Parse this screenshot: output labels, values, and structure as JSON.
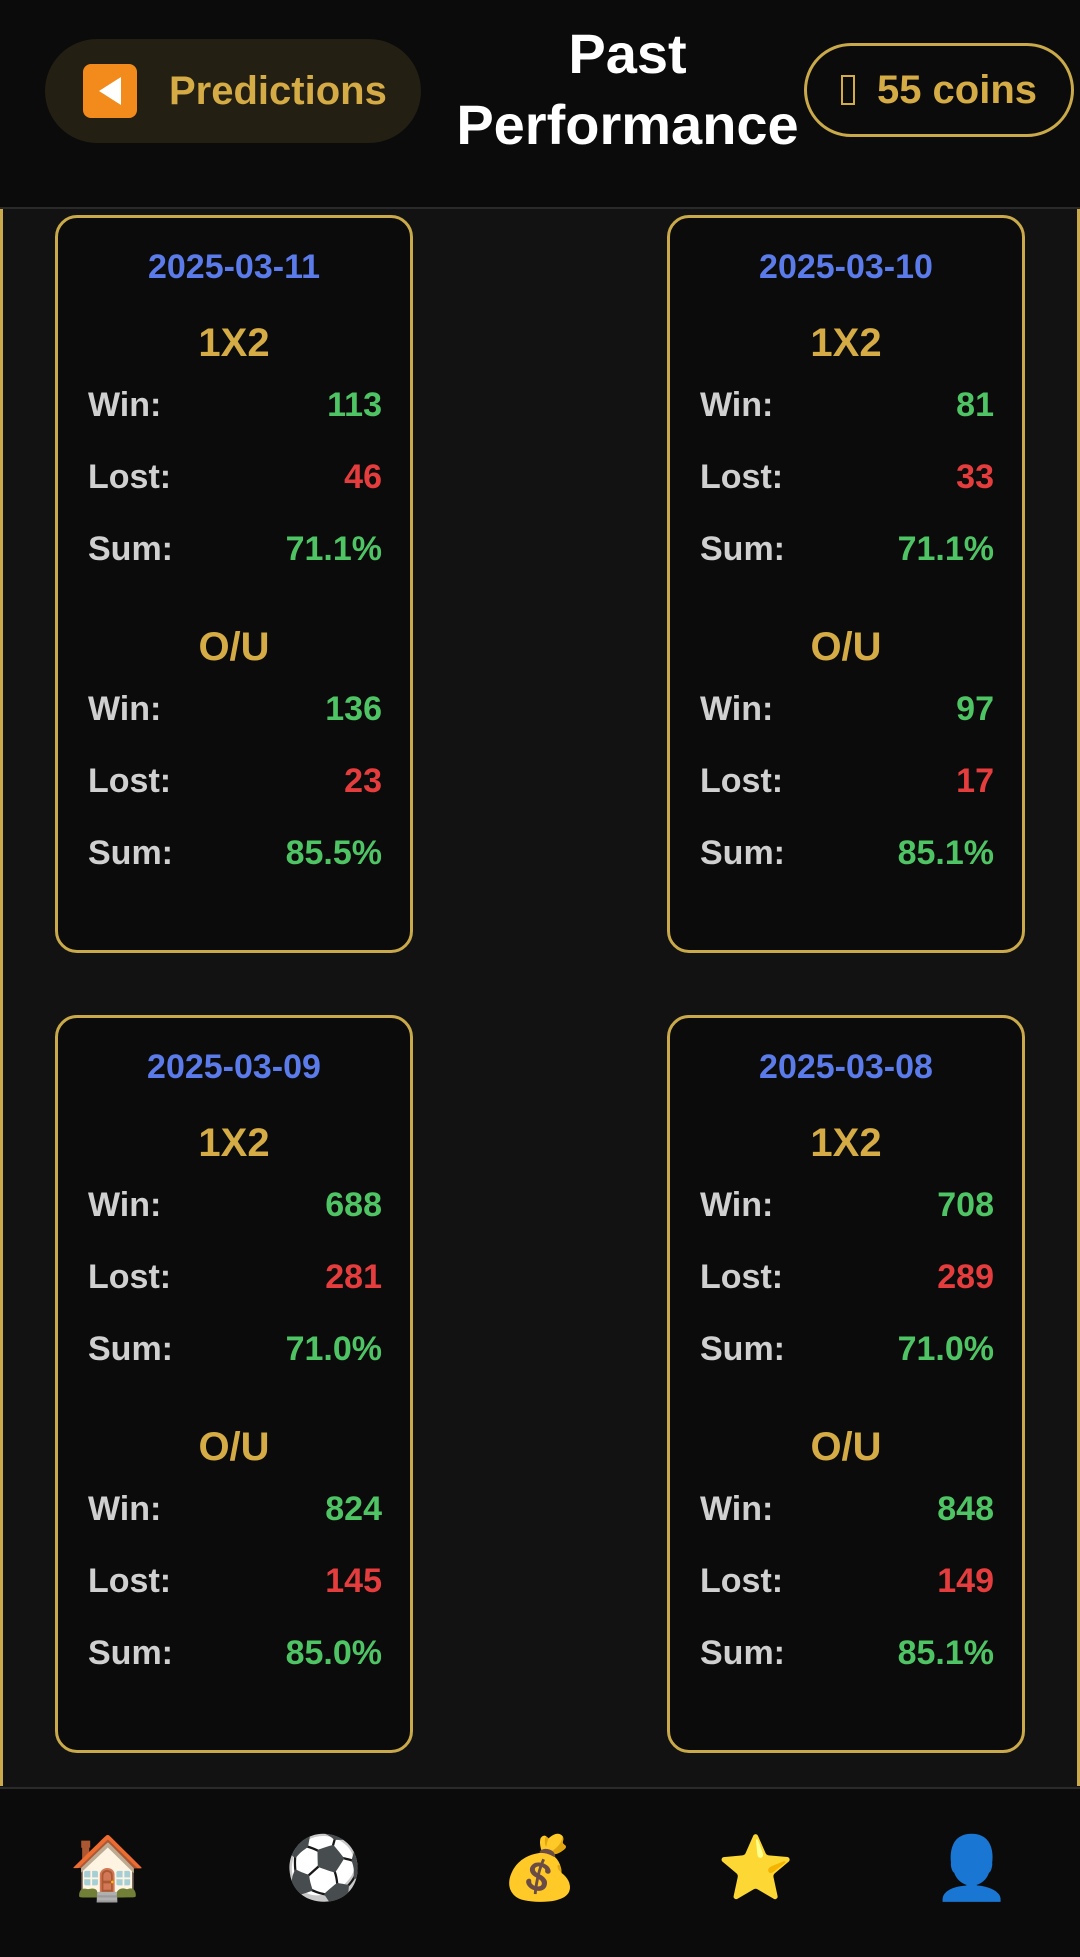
{
  "header": {
    "back_label": "Predictions",
    "title_line1": "Past",
    "title_line2": "Performance",
    "coins_label": "55 coins",
    "back_icon": "back-arrow-icon",
    "coins_icon": "coin-icon"
  },
  "cards": [
    {
      "date": "2025-03-11",
      "one_x_two": {
        "title": "1X2",
        "win_label": "Win:",
        "win": "113",
        "lost_label": "Lost:",
        "lost": "46",
        "sum_label": "Sum:",
        "sum": "71.1%"
      },
      "ou": {
        "title": "O/U",
        "win_label": "Win:",
        "win": "136",
        "lost_label": "Lost:",
        "lost": "23",
        "sum_label": "Sum:",
        "sum": "85.5%"
      }
    },
    {
      "date": "2025-03-10",
      "one_x_two": {
        "title": "1X2",
        "win_label": "Win:",
        "win": "81",
        "lost_label": "Lost:",
        "lost": "33",
        "sum_label": "Sum:",
        "sum": "71.1%"
      },
      "ou": {
        "title": "O/U",
        "win_label": "Win:",
        "win": "97",
        "lost_label": "Lost:",
        "lost": "17",
        "sum_label": "Sum:",
        "sum": "85.1%"
      }
    },
    {
      "date": "2025-03-09",
      "one_x_two": {
        "title": "1X2",
        "win_label": "Win:",
        "win": "688",
        "lost_label": "Lost:",
        "lost": "281",
        "sum_label": "Sum:",
        "sum": "71.0%"
      },
      "ou": {
        "title": "O/U",
        "win_label": "Win:",
        "win": "824",
        "lost_label": "Lost:",
        "lost": "145",
        "sum_label": "Sum:",
        "sum": "85.0%"
      }
    },
    {
      "date": "2025-03-08",
      "one_x_two": {
        "title": "1X2",
        "win_label": "Win:",
        "win": "708",
        "lost_label": "Lost:",
        "lost": "289",
        "sum_label": "Sum:",
        "sum": "71.0%"
      },
      "ou": {
        "title": "O/U",
        "win_label": "Win:",
        "win": "848",
        "lost_label": "Lost:",
        "lost": "149",
        "sum_label": "Sum:",
        "sum": "85.1%"
      }
    }
  ],
  "nav": {
    "items": [
      {
        "icon": "home-icon",
        "glyph": "🏠"
      },
      {
        "icon": "soccer-ball-icon",
        "glyph": "⚽"
      },
      {
        "icon": "money-bag-icon",
        "glyph": "💰"
      },
      {
        "icon": "star-icon",
        "glyph": "⭐"
      },
      {
        "icon": "profile-icon",
        "glyph": "👤"
      }
    ]
  },
  "colors": {
    "accent": "#c9a94a",
    "date": "#5b7bea",
    "win": "#4fc464",
    "lost": "#e53d3d",
    "background": "#121212"
  }
}
